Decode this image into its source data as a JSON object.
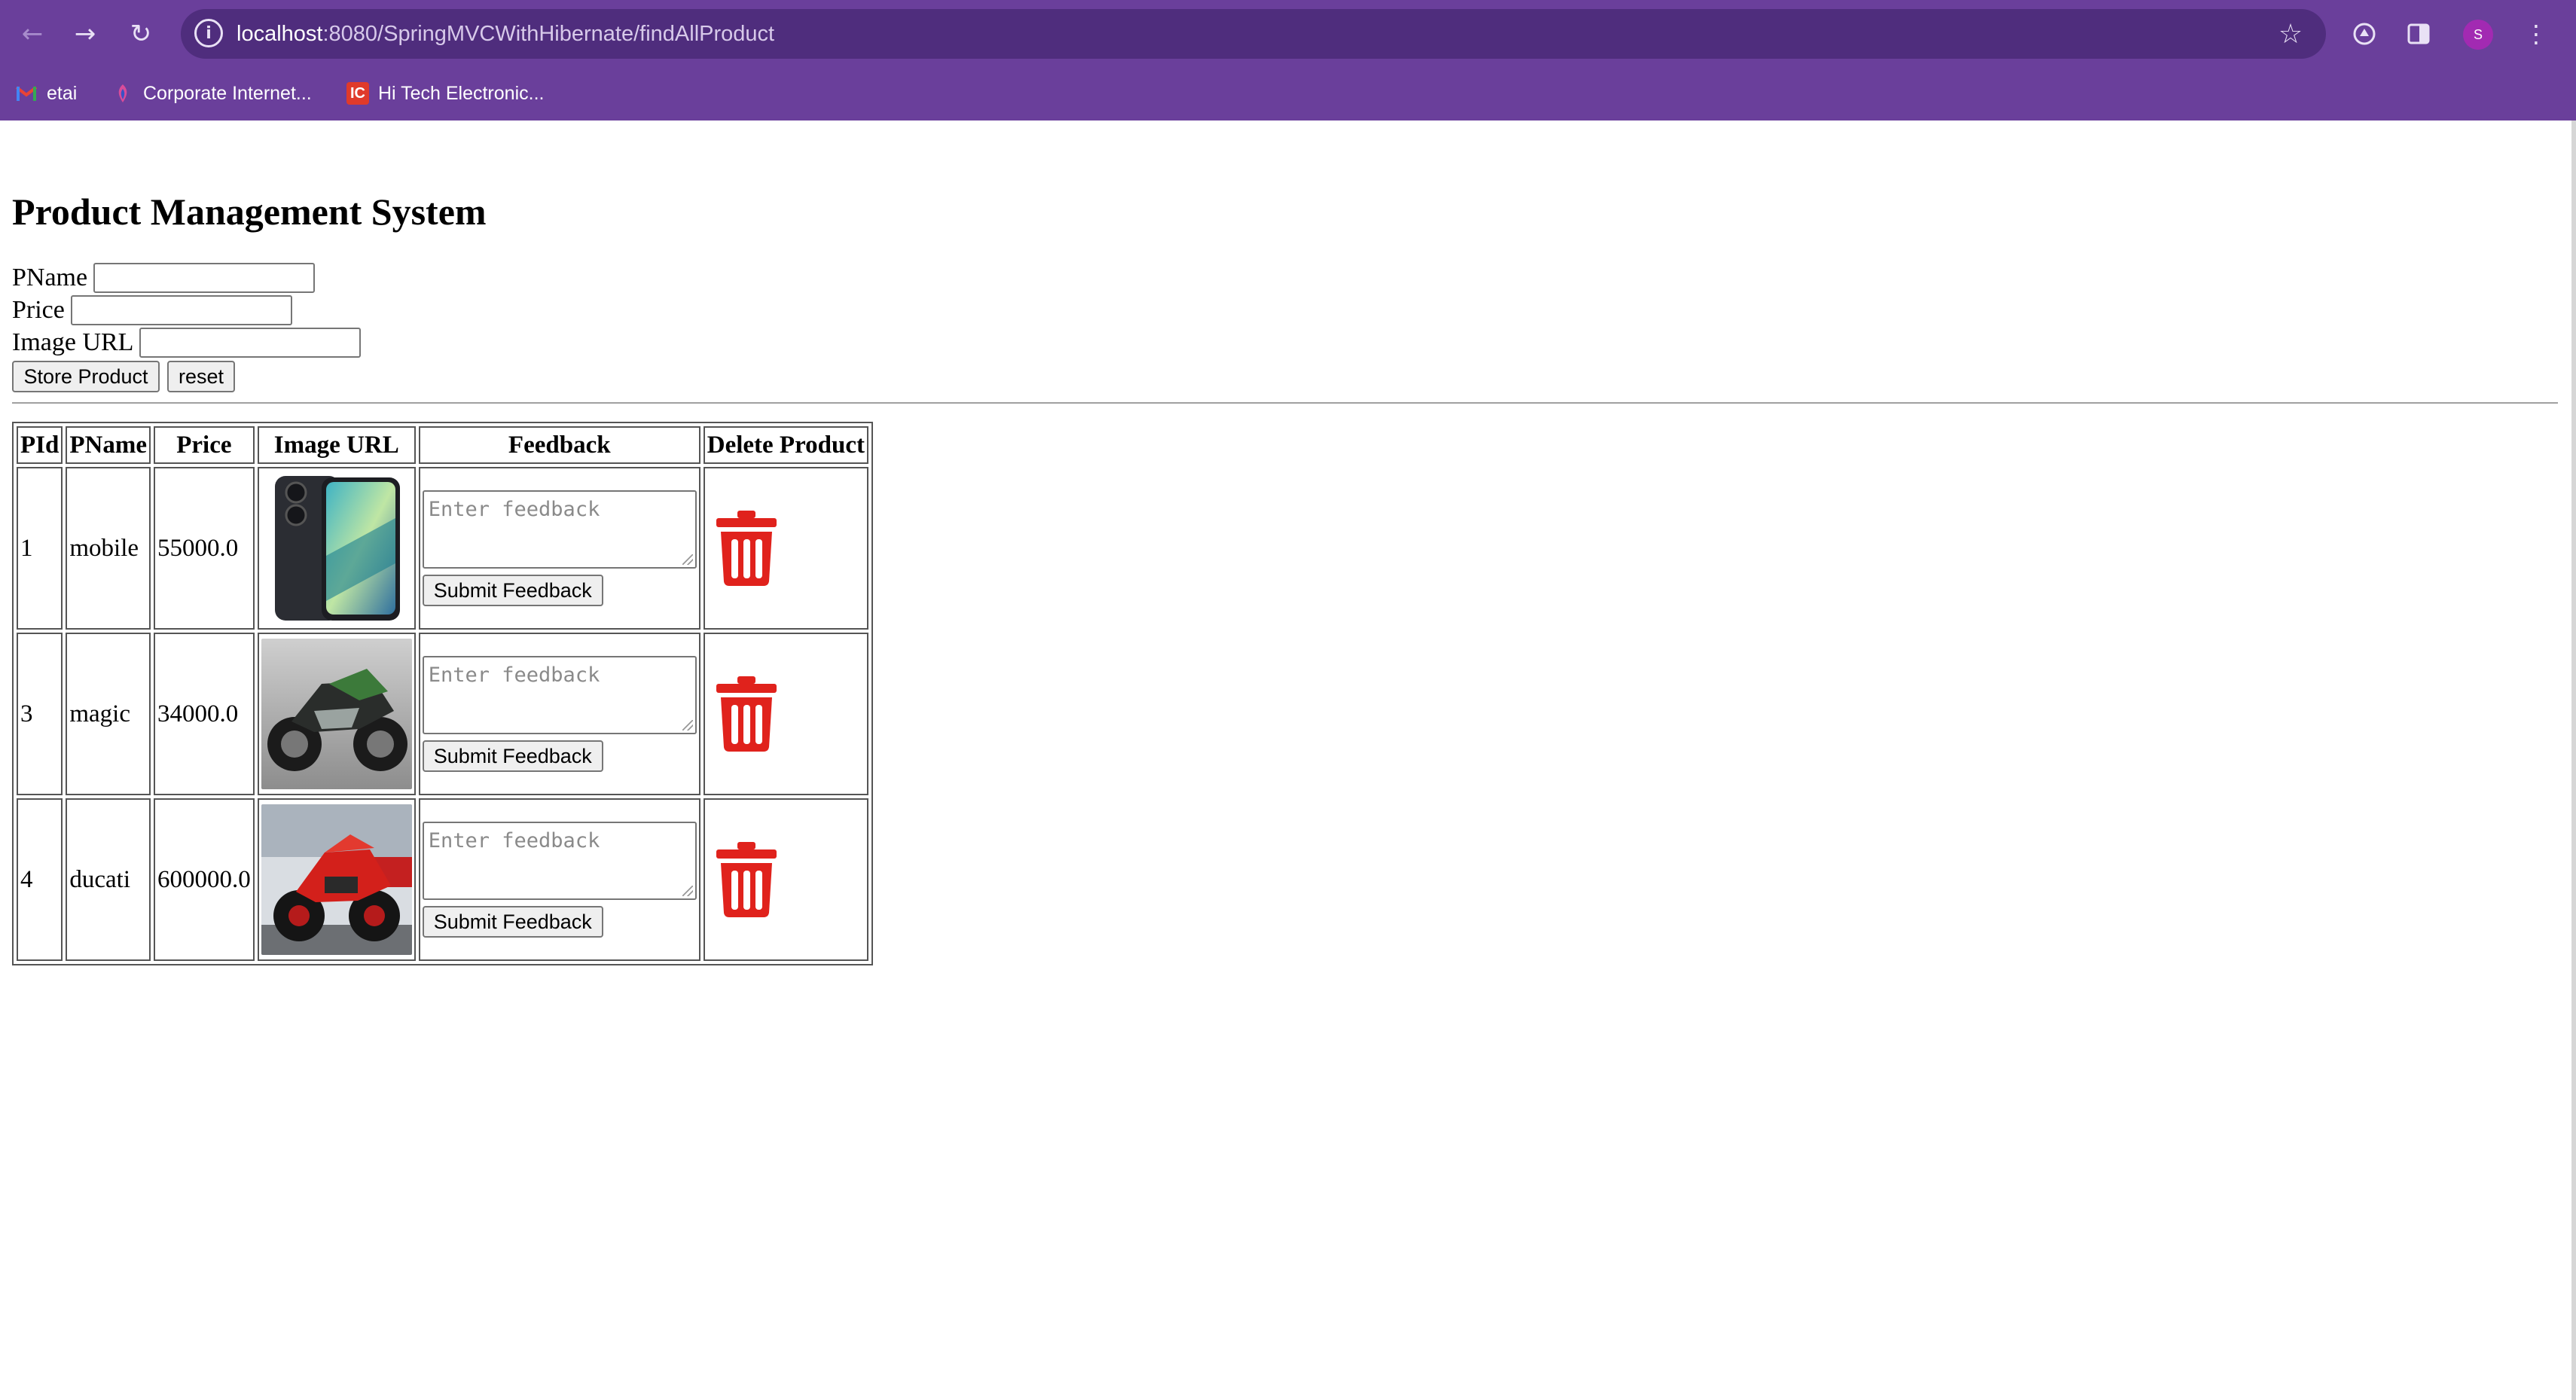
{
  "browser": {
    "url_host": "localhost",
    "url_rest": ":8080/SpringMVCWithHibernate/findAllProduct",
    "avatar_letter": "S",
    "icons": {
      "back": "back-arrow-icon",
      "forward": "forward-arrow-icon",
      "reload": "reload-icon",
      "info": "site-info-icon",
      "star": "bookmark-star-icon",
      "extension": "extension-icon",
      "side_panel": "side-panel-icon",
      "menu": "kebab-menu-icon"
    },
    "bookmarks": [
      {
        "label": "etai",
        "icon": "gmail-icon"
      },
      {
        "label": "Corporate Internet...",
        "icon": "corporate-icon"
      },
      {
        "label": "Hi Tech Electronic...",
        "icon": "hitech-icon"
      }
    ],
    "colors": {
      "chrome": "#6a3f9b",
      "omnibox": "#4f2d7d",
      "avatar": "#a22ab2"
    }
  },
  "page": {
    "title": "Product Management System",
    "form": {
      "pname_label": "PName",
      "pname_value": "",
      "price_label": "Price",
      "price_value": "",
      "image_url_label": "Image URL",
      "image_url_value": "",
      "store_button": "Store Product",
      "reset_button": "reset"
    },
    "table": {
      "headers": [
        "PId",
        "PName",
        "Price",
        "Image URL",
        "Feedback",
        "Delete Product"
      ],
      "feedback_placeholder": "Enter feedback",
      "submit_label": "Submit Feedback",
      "rows": [
        {
          "pid": "1",
          "pname": "mobile",
          "price": "55000.0",
          "image": "smartphone-image"
        },
        {
          "pid": "3",
          "pname": "magic",
          "price": "34000.0",
          "image": "motorcycle-image"
        },
        {
          "pid": "4",
          "pname": "ducati",
          "price": "600000.0",
          "image": "red-ducati-image"
        }
      ],
      "delete_icon": "trash-icon",
      "delete_color": "#e0221c"
    }
  }
}
